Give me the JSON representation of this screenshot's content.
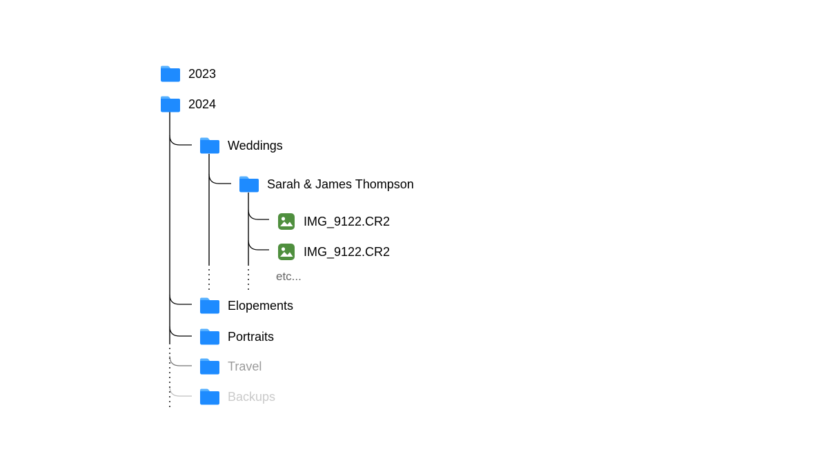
{
  "tree": {
    "year2023": "2023",
    "year2024": "2024",
    "weddings": "Weddings",
    "couple": "Sarah & James Thompson",
    "file1": "IMG_9122.CR2",
    "file2": "IMG_9122.CR2",
    "etc": "etc...",
    "elopements": "Elopements",
    "portraits": "Portraits",
    "travel": "Travel",
    "backups": "Backups"
  },
  "colors": {
    "folder_primary": "#1e8bff",
    "folder_tab": "#56b0ff",
    "image_icon": "#4f8f3e"
  }
}
